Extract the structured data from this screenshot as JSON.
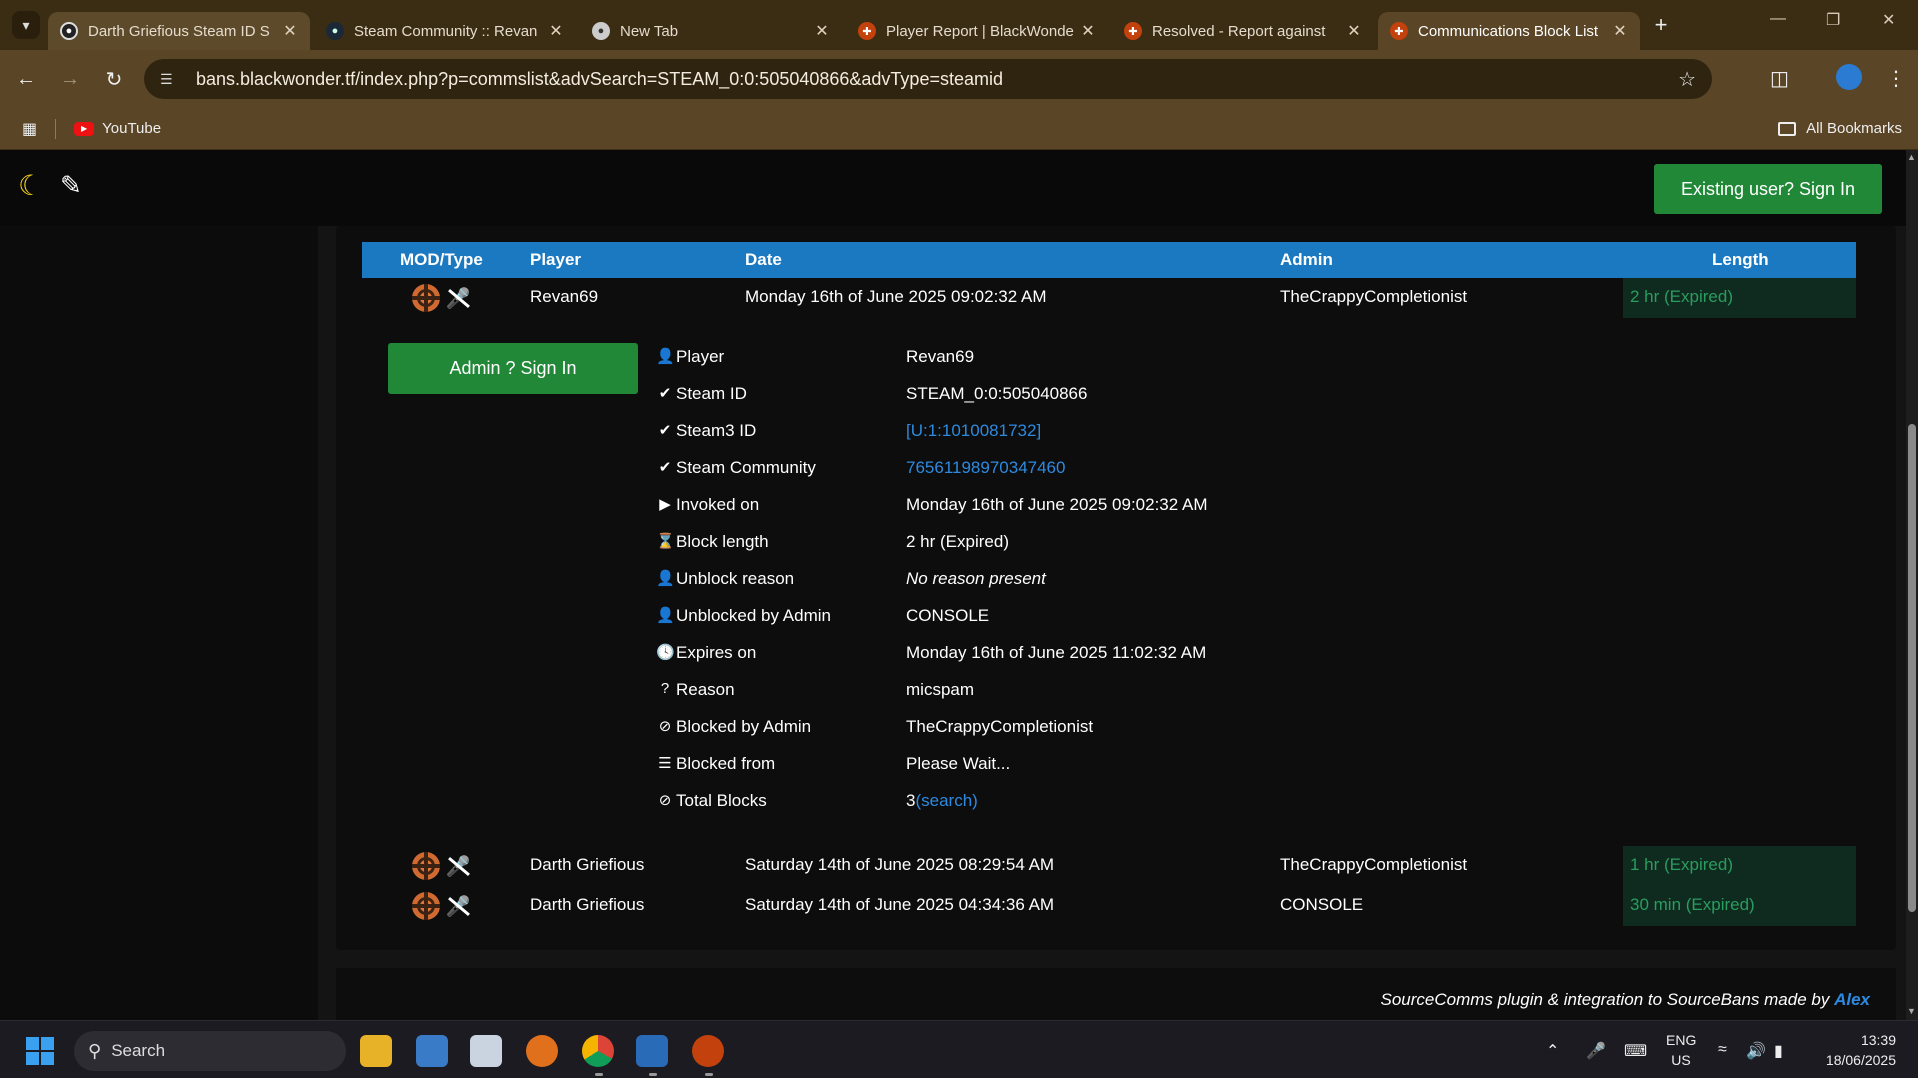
{
  "browser": {
    "tabs": [
      {
        "title": "Darth Griefious Steam ID S",
        "favicon": "google-lens-icon",
        "state": "dim"
      },
      {
        "title": "Steam Community :: Revan",
        "favicon": "steam-icon",
        "state": "normal"
      },
      {
        "title": "New Tab",
        "favicon": "chrome-icon",
        "state": "normal"
      },
      {
        "title": "Player Report | BlackWonde",
        "favicon": "tf2-icon",
        "state": "normal"
      },
      {
        "title": "Resolved - Report against",
        "favicon": "tf2-icon",
        "state": "normal"
      },
      {
        "title": "Communications Block List",
        "favicon": "tf2-icon",
        "state": "active"
      }
    ],
    "url": "bans.blackwonder.tf/index.php?p=commslist&advSearch=STEAM_0:0:505040866&advType=steamid",
    "bookmarks": [
      {
        "label": "YouTube"
      }
    ],
    "all_bookmarks_label": "All Bookmarks"
  },
  "page": {
    "signin_label": "Existing user? Sign In",
    "admin_signin_label": "Admin ? Sign In",
    "table": {
      "headers": {
        "mod": "MOD/Type",
        "player": "Player",
        "date": "Date",
        "admin": "Admin",
        "length": "Length"
      },
      "rows": [
        {
          "player": "Revan69",
          "date": "Monday 16th of June 2025 09:02:32 AM",
          "admin": "TheCrappyCompletionist",
          "length": "2 hr (Expired)"
        },
        {
          "player": "Darth Griefious",
          "date": "Saturday 14th of June 2025 08:29:54 AM",
          "admin": "TheCrappyCompletionist",
          "length": "1 hr (Expired)"
        },
        {
          "player": "Darth Griefious",
          "date": "Saturday 14th of June 2025 04:34:36 AM",
          "admin": "CONSOLE",
          "length": "30 min (Expired)"
        }
      ]
    },
    "details": [
      {
        "label": "Player",
        "value": "Revan69"
      },
      {
        "label": "Steam ID",
        "value": "STEAM_0:0:505040866"
      },
      {
        "label": "Steam3 ID",
        "value": "[U:1:1010081732]"
      },
      {
        "label": "Steam Community",
        "value": "76561198970347460"
      },
      {
        "label": "Invoked on",
        "value": "Monday 16th of June 2025 09:02:32 AM"
      },
      {
        "label": "Block length",
        "value": "2 hr (Expired)"
      },
      {
        "label": "Unblock reason",
        "value": "No reason present"
      },
      {
        "label": "Unblocked by Admin",
        "value": "CONSOLE"
      },
      {
        "label": "Expires on",
        "value": "Monday 16th of June 2025 11:02:32 AM"
      },
      {
        "label": "Reason",
        "value": "micspam"
      },
      {
        "label": "Blocked by Admin",
        "value": "TheCrappyCompletionist"
      },
      {
        "label": "Blocked from",
        "value": "Please Wait..."
      },
      {
        "label": "Total Blocks",
        "value": "3",
        "search": "(search)"
      }
    ],
    "footer_text": "SourceComms plugin & integration to SourceBans made by",
    "footer_author": "Alex"
  },
  "taskbar": {
    "search_placeholder": "Search",
    "lang_line1": "ENG",
    "lang_line2": "US",
    "time": "13:39",
    "date": "18/06/2025"
  },
  "colors": {
    "accent_blue": "#1b79c1",
    "signin_green": "#218838",
    "expired_green": "#2a9d5f",
    "link_blue": "#2d8ae0"
  }
}
